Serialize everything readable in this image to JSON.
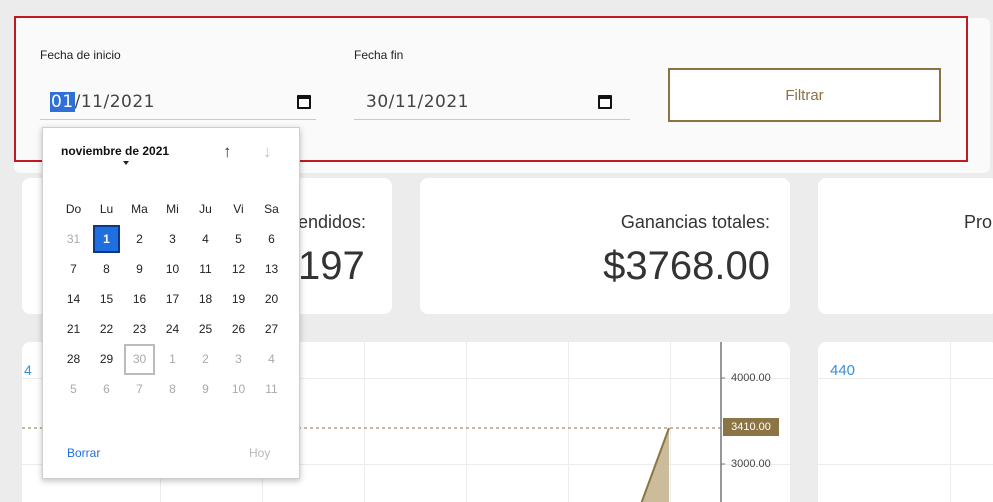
{
  "filters": {
    "start_label": "Fecha de inicio",
    "start_value_day": "01",
    "start_value_rest": "/11/2021",
    "end_label": "Fecha fin",
    "end_value": "30/11/2021",
    "filter_button": "Filtrar"
  },
  "stats": {
    "sold_title": "endidos:",
    "sold_value": "197",
    "earnings_title": "Ganancias totales:",
    "earnings_value": "$3768.00",
    "third_title": "Pro"
  },
  "chart_left": {
    "axis_labels": [
      "4000.00",
      "3000.00"
    ],
    "highlight_label": "3410.00",
    "top_left_partial": "4",
    "colors": {
      "highlight": "#8b7544",
      "area": "#cbbd9b"
    }
  },
  "chart_right": {
    "top_value": "440",
    "colors": {
      "value_text": "#3a8fd9"
    }
  },
  "datepicker": {
    "month_title": "noviembre de 2021",
    "weekdays": [
      "Do",
      "Lu",
      "Ma",
      "Mi",
      "Ju",
      "Vi",
      "Sa"
    ],
    "weeks": [
      [
        "31",
        "1",
        "2",
        "3",
        "4",
        "5",
        "6"
      ],
      [
        "7",
        "8",
        "9",
        "10",
        "11",
        "12",
        "13"
      ],
      [
        "14",
        "15",
        "16",
        "17",
        "18",
        "19",
        "20"
      ],
      [
        "21",
        "22",
        "23",
        "24",
        "25",
        "26",
        "27"
      ],
      [
        "28",
        "29",
        "30",
        "1",
        "2",
        "3",
        "4"
      ],
      [
        "5",
        "6",
        "7",
        "8",
        "9",
        "10",
        "11"
      ]
    ],
    "clear_label": "Borrar",
    "today_label": "Hoy",
    "up_icon": "arrow-up-icon",
    "down_icon": "arrow-down-icon",
    "colors": {
      "selected": "#1f6fe0"
    }
  }
}
